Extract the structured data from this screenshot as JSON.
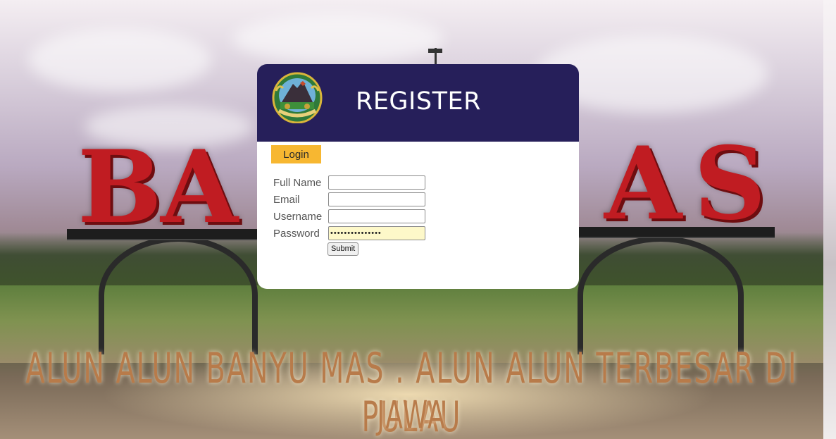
{
  "background": {
    "sign_letters_left": [
      "B",
      "A"
    ],
    "sign_letters_right": [
      "A",
      "S"
    ],
    "tagline_line1": "ALUN ALUN BANYU MAS . ALUN ALUN TERBESAR DI PULAU",
    "tagline_line2": "JAWA"
  },
  "header": {
    "title": "REGISTER",
    "emblem_icon": "regency-emblem-icon"
  },
  "tabs": {
    "login_label": "Login"
  },
  "form": {
    "full_name_label": "Full Name",
    "email_label": "Email",
    "username_label": "Username",
    "password_label": "Password",
    "full_name_value": "",
    "email_value": "",
    "username_value": "",
    "password_value": "•••••••••••••••",
    "submit_label": "Submit"
  },
  "colors": {
    "header_bg": "#261f5a",
    "login_tab_bg": "#f7b731",
    "password_autofill_bg": "#fdf8c9"
  }
}
